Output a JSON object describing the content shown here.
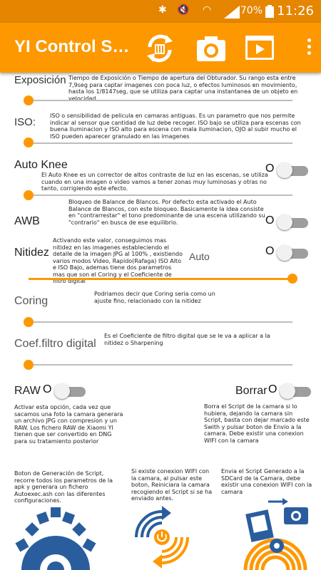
{
  "status": {
    "battery": "70%",
    "time": "11:26"
  },
  "app": {
    "title": "YI Control S…"
  },
  "exposicion": {
    "label": "Exposición",
    "desc": "Tiempo de Exposición o Tiempo de apertura del Obturador. Su rango esta entre 7,9seg para captar imagenes con poca luz, o efectos luminosos en movimiento, hasta los 1/8147seg, que se utiliza para captar una instantanea de un objeto en velocidad.",
    "value": 0
  },
  "iso": {
    "label": "ISO:",
    "desc": "ISO o sensibilidad de pelicula en camaras antiguas. Es un parametro que nos permite indicar al sensor que cantidad de luz debe recoger. ISO bajo se utiliza para escenas con buena iluminacion y ISO alto para escena con mala iluminacion, OJO al subir mucho el ISO pueden aparecer granulado en las imagenes",
    "value": 0
  },
  "autoknee": {
    "label": "Auto Knee",
    "desc": "El Auto Knee es un corrector de altos contraste de luz en las escenas, se utiliza cuando en una imagen o video vamos a tener zonas muy luminosas y otras no tanto, corrigiendo este efecto.",
    "toggle": "O",
    "value": 0
  },
  "awb": {
    "label": "AWB",
    "desc": "Bloqueo de Balance de Blancos. Por defecto esta activado el Auto Balance de Blancos, con este bloqueo. Basicamente la idea consiste en \"contrarrestar\" el tono predominante de una escena utilizando su \"contrario\" en busca de ese equilibrio.",
    "toggle": "O"
  },
  "nitidez": {
    "label": "Nitidez",
    "desc": "Activando este valor, conseguimos mas nitidez en las imagenes estableciendo el detalle de la imagen JPG al 100% , existiendo varios modos Video, Rapido(Rafaga) ISO Alto e ISO Bajo, ademas tiene dos parametros mas que son el Coring y el Coeficiente de filtro digital",
    "auto": "Auto",
    "toggle": "O",
    "value": 1
  },
  "coring": {
    "label": "Coring",
    "desc": "Podriamos decir que Coring seria como un ajuste fino, relacionado con la nitidez",
    "value": 0
  },
  "coef": {
    "label": "Coef.filtro digital",
    "desc": "Es el Coeficiente de filtro digital que se le va a aplicar a la nitidez o Sharpening",
    "value": 0
  },
  "raw": {
    "label": "RAW",
    "toggle": "O",
    "desc": "Activar esta opción, cada vez que sacamos una foto la camara generara un archivo JPG con compresion y un RAW. Los fichero RAW de Xiaomi YI tienen que ser convertido en DNG para su tratamiento posterior"
  },
  "borrar": {
    "label": "Borrar",
    "toggle": "O",
    "desc": "Borra el Script de la camara si lo hubiera, dejando la camara sin Script, basta con dejar marcado este Swith y pulsar boton de Envio a la camara. Debe existir una conexion WIFI con la camara"
  },
  "gen": {
    "desc": "Boton de Generación de Script, recorre todos los parametros de la apk y generara un fichero Autoexec.ash con las diferentes configuraciones."
  },
  "reboot": {
    "desc": "Si existe conexion WIFI con la camara, al pulsar este boton, Reiniciara la camara recogiendo el Script si se ha enviado antes."
  },
  "send": {
    "desc": "Envia el Script Generado a la SDCard de la Camara, debe existir una conexion WIFI con la camara"
  },
  "colors": {
    "accent": "#fd9800",
    "blue": "#2a5d9e"
  }
}
